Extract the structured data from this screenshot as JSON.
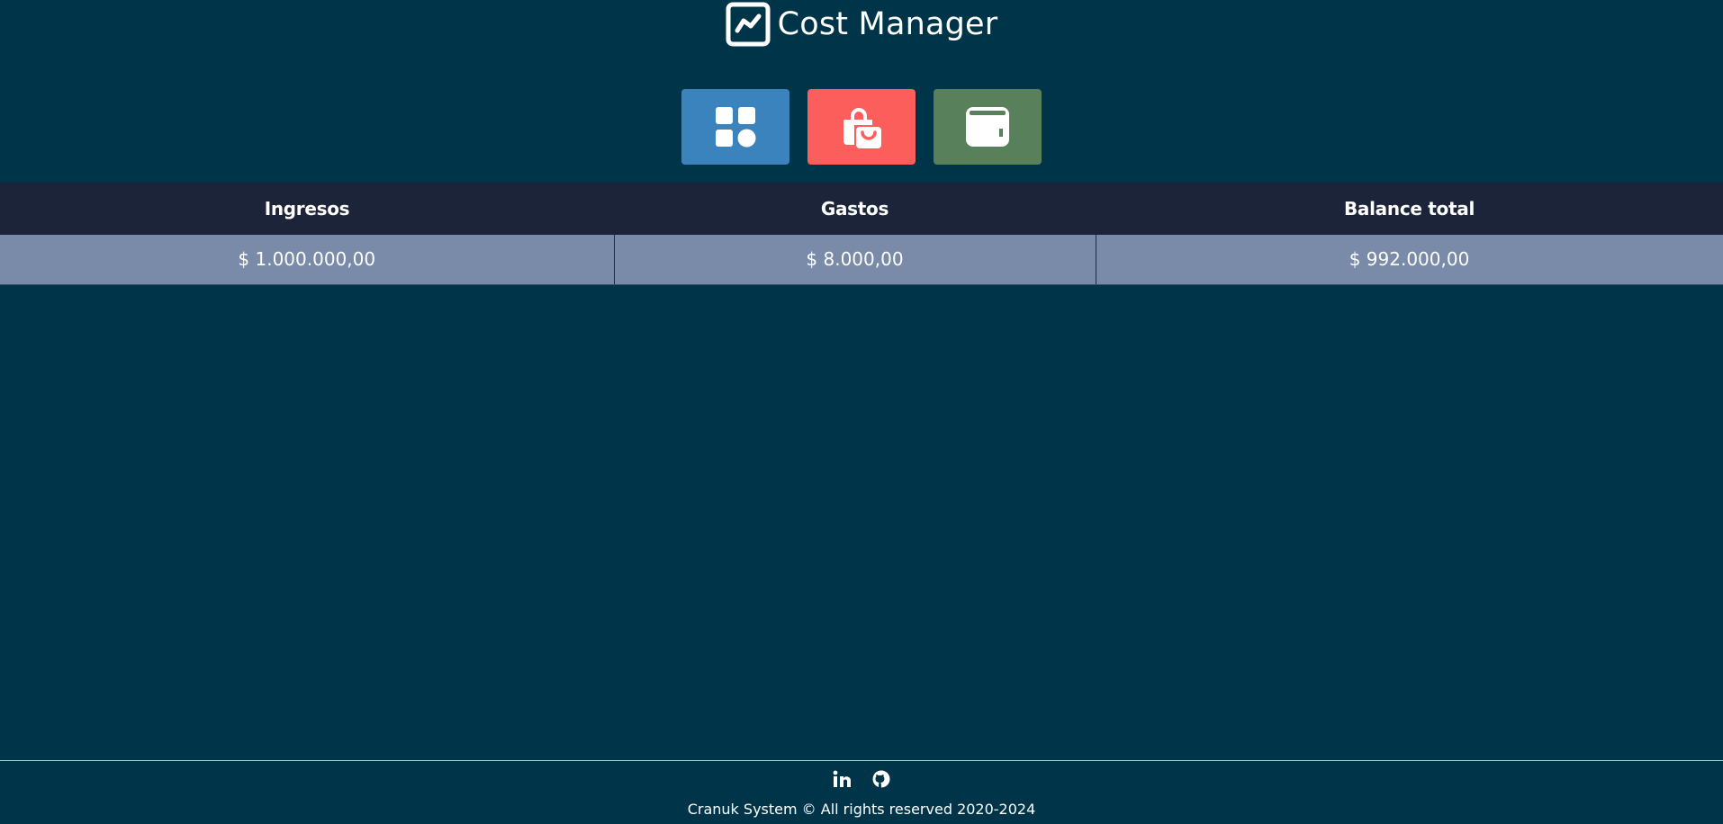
{
  "header": {
    "title": "Cost Manager",
    "logo_icon": "chart-line-icon"
  },
  "actions": [
    {
      "name": "dashboard",
      "icon": "dashboard-grid-icon",
      "color": "#3a83bd"
    },
    {
      "name": "expenses",
      "icon": "shopping-bags-icon",
      "color": "#fc5e5c"
    },
    {
      "name": "income",
      "icon": "wallet-icon",
      "color": "#58805a"
    }
  ],
  "summary": {
    "headers": [
      "Ingresos",
      "Gastos",
      "Balance total"
    ],
    "values": [
      "$ 1.000.000,00",
      "$ 8.000,00",
      "$ 992.000,00"
    ]
  },
  "colors": {
    "background": "#003549",
    "table_header": "#1c2439",
    "table_row": "#798ba8"
  },
  "footer": {
    "social": [
      {
        "name": "linkedin",
        "icon": "linkedin-icon"
      },
      {
        "name": "github",
        "icon": "github-icon"
      }
    ],
    "copyright": "Cranuk System © All rights reserved 2020-2024"
  }
}
